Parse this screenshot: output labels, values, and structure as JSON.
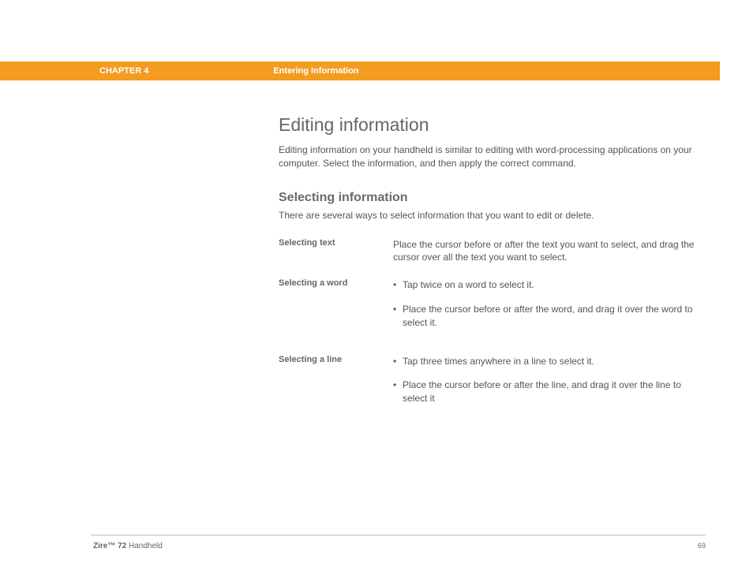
{
  "header": {
    "chapter": "CHAPTER 4",
    "section": "Entering Information"
  },
  "content": {
    "title": "Editing information",
    "intro": "Editing information on your handheld is similar to editing with word-processing applications on your computer. Select the information, and then apply the correct command.",
    "subtitle": "Selecting information",
    "subintro": "There are several ways to select information that you want to edit or delete.",
    "rows": [
      {
        "label": "Selecting text",
        "plain": "Place the cursor before or after the text you want to select, and drag the cursor over all the text you want to select."
      },
      {
        "label": "Selecting a word",
        "bullets": [
          "Tap twice on a word to select it.",
          "Place the cursor before or after the word, and drag it over the word to select it."
        ]
      },
      {
        "label": "Selecting a line",
        "bullets": [
          "Tap three times anywhere in a line to select it.",
          "Place the cursor before or after the line, and drag it over the line to select it"
        ]
      }
    ]
  },
  "footer": {
    "product_bold": "Zire™ 72",
    "product_rest": " Handheld",
    "page": "69"
  }
}
